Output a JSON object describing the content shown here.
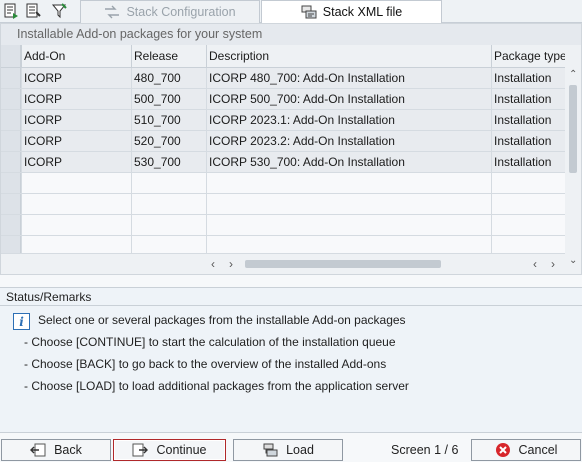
{
  "tabs": [
    {
      "label": "Stack Configuration",
      "state": "inactive",
      "icon": "stack-arrows-icon"
    },
    {
      "label": "Stack XML file",
      "state": "active",
      "icon": "xml-file-icon"
    }
  ],
  "table": {
    "title": "Installable Add-on packages for your system",
    "columns": [
      "Add-On",
      "Release",
      "Description",
      "Package type"
    ],
    "rows": [
      [
        "ICORP",
        "480_700",
        "ICORP 480_700: Add-On Installation",
        "Installation"
      ],
      [
        "ICORP",
        "500_700",
        "ICORP 500_700: Add-On Installation",
        "Installation"
      ],
      [
        "ICORP",
        "510_700",
        "ICORP 2023.1: Add-On Installation",
        "Installation"
      ],
      [
        "ICORP",
        "520_700",
        "ICORP 2023.2: Add-On Installation",
        "Installation"
      ],
      [
        "ICORP",
        "530_700",
        "ICORP 530_700: Add-On Installation",
        "Installation"
      ]
    ]
  },
  "status": {
    "title": "Status/Remarks",
    "lines": [
      "Select one or several packages from the installable Add-on packages",
      "- Choose [CONTINUE] to start the calculation of the installation queue",
      "- Choose [BACK] to go back to the overview of the installed Add-ons",
      "- Choose [LOAD] to load additional packages from the application server"
    ]
  },
  "footer": {
    "back": "Back",
    "continue": "Continue",
    "load": "Load",
    "screen": "Screen 1 / 6",
    "cancel": "Cancel"
  },
  "colors": {
    "accent": "#2d6fb5",
    "cancel_red": "#d7262b",
    "primary_border": "#b0282a"
  }
}
